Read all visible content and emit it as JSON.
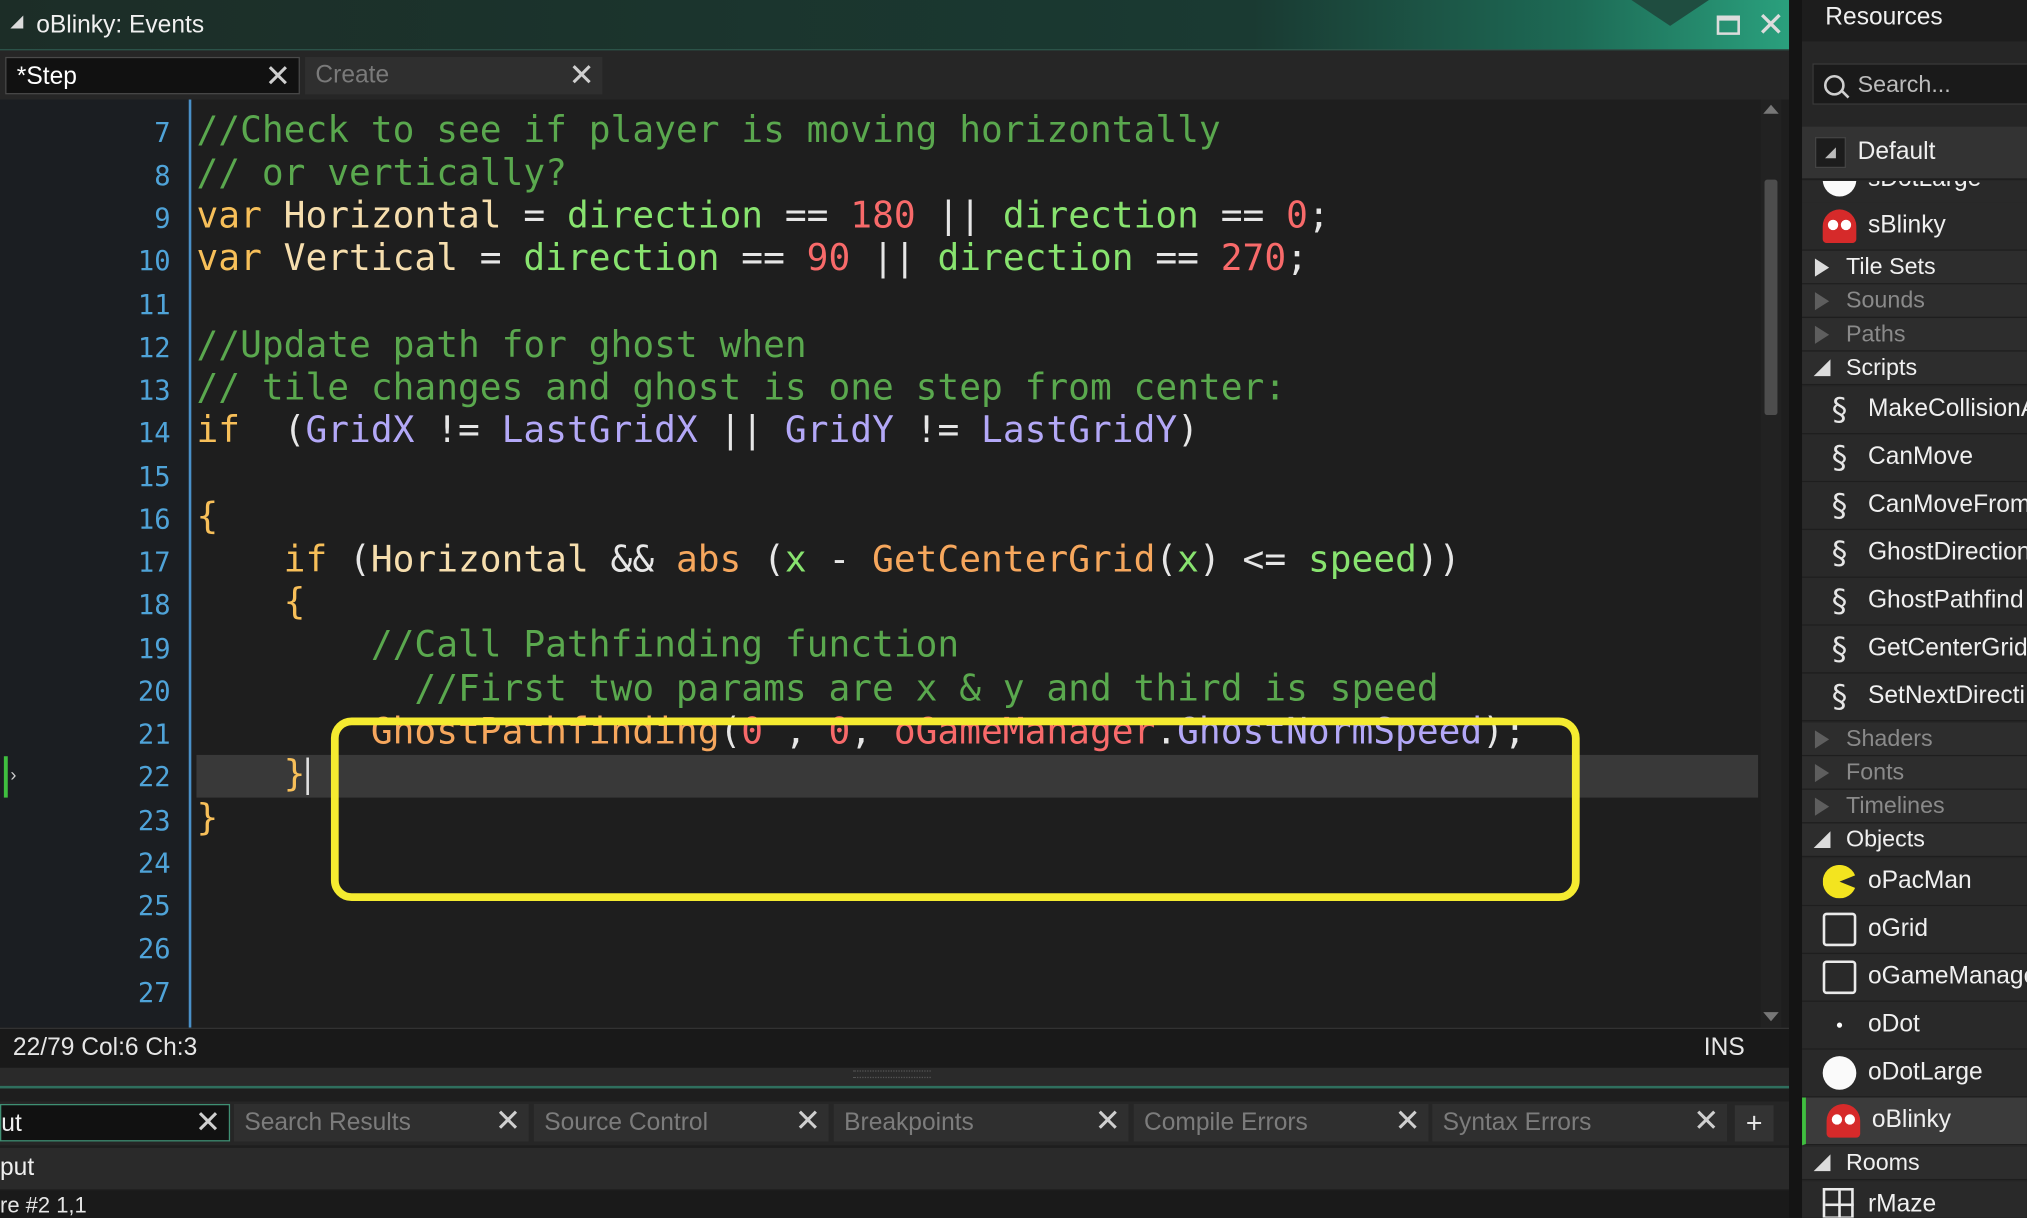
{
  "window": {
    "title": "oBlinky: Events"
  },
  "editor_tabs": [
    {
      "label": "*Step"
    },
    {
      "label": "Create"
    }
  ],
  "gutter_lines": [
    "7",
    "8",
    "9",
    "10",
    "11",
    "12",
    "13",
    "14",
    "15",
    "16",
    "17",
    "18",
    "19",
    "20",
    "21",
    "22",
    "23",
    "24",
    "25",
    "26",
    "27"
  ],
  "code": {
    "l7": "//Check to see if player is moving horizontally",
    "l8": "// or vertically?",
    "l9": {
      "kw": "var",
      "name": " Horizontal",
      "t1": " = ",
      "d1": "direction",
      "t2": " == ",
      "n1": "180",
      "t3": " || ",
      "d2": "direction",
      "t4": " == ",
      "n2": "0",
      "t5": ";"
    },
    "l10": {
      "kw": "var",
      "name": " Vertical",
      "t1": " = ",
      "d1": "direction",
      "t2": " == ",
      "n1": "90",
      "t3": " || ",
      "d2": "direction",
      "t4": " == ",
      "n2": "270",
      "t5": ";"
    },
    "l12": "//Update path for ghost when",
    "l13": "// tile changes and ghost is one step from center:",
    "l14": {
      "kw": "if",
      "t1": "  (",
      "a": "GridX",
      "t2": " != ",
      "b": "LastGridX",
      "t3": " || ",
      "c": "GridY",
      "t4": " != ",
      "d": "LastGridY",
      "t5": ")"
    },
    "l16": "{",
    "l17": {
      "indent": "    ",
      "kw": "if",
      "t1": " (",
      "v": "Horizontal",
      "t2": " && ",
      "f1": "abs",
      "t3": " (",
      "x1": "x",
      "t4": " - ",
      "f2": "GetCenterGrid",
      "t5": "(",
      "x2": "x",
      "t6": ") <= ",
      "s": "speed",
      "t7": "))"
    },
    "l18": "    {",
    "l19": "        //Call Pathfinding function",
    "l20": "          //First two params are x & y and third is speed",
    "l21": {
      "indent": "        ",
      "f": "GhostPathfinding",
      "t1": "(",
      "n1": "0",
      "t2": " , ",
      "n2": "0",
      "t3": ", ",
      "o": "oGameManager",
      "t4": ".",
      "p": "GhostNormSpeed",
      "t5": ");"
    },
    "l22": "    }",
    "l23": "}"
  },
  "status": {
    "position": "22/79 Col:6 Ch:3",
    "mode": "INS"
  },
  "output_tabs": [
    {
      "label": "ut"
    },
    {
      "label": "Search Results"
    },
    {
      "label": "Source Control"
    },
    {
      "label": "Breakpoints"
    },
    {
      "label": "Compile Errors"
    },
    {
      "label": "Syntax Errors"
    }
  ],
  "output": {
    "header": "put",
    "line": "re #2 1,1"
  },
  "resources": {
    "title": "Resources",
    "search_placeholder": "Search...",
    "default_label": "Default",
    "partial_item": "sDotLarge",
    "sprite_items": [
      "sBlinky"
    ],
    "folders": {
      "tilesets": "Tile Sets",
      "sounds": "Sounds",
      "paths": "Paths",
      "scripts": "Scripts",
      "shaders": "Shaders",
      "fonts": "Fonts",
      "timelines": "Timelines",
      "objects": "Objects",
      "rooms": "Rooms"
    },
    "scripts": [
      "MakeCollisionA",
      "CanMove",
      "CanMoveFrom",
      "GhostDirection",
      "GhostPathfind",
      "GetCenterGrid",
      "SetNextDirecti"
    ],
    "objects": [
      "oPacMan",
      "oGrid",
      "oGameManage",
      "oDot",
      "oDotLarge",
      "oBlinky"
    ],
    "rooms": [
      "rMaze"
    ]
  },
  "colors": {
    "accent": "#2aa07d",
    "highlight": "#f5eb30",
    "line_numbers": "#4fa3d8",
    "comment": "#5aa84e"
  }
}
